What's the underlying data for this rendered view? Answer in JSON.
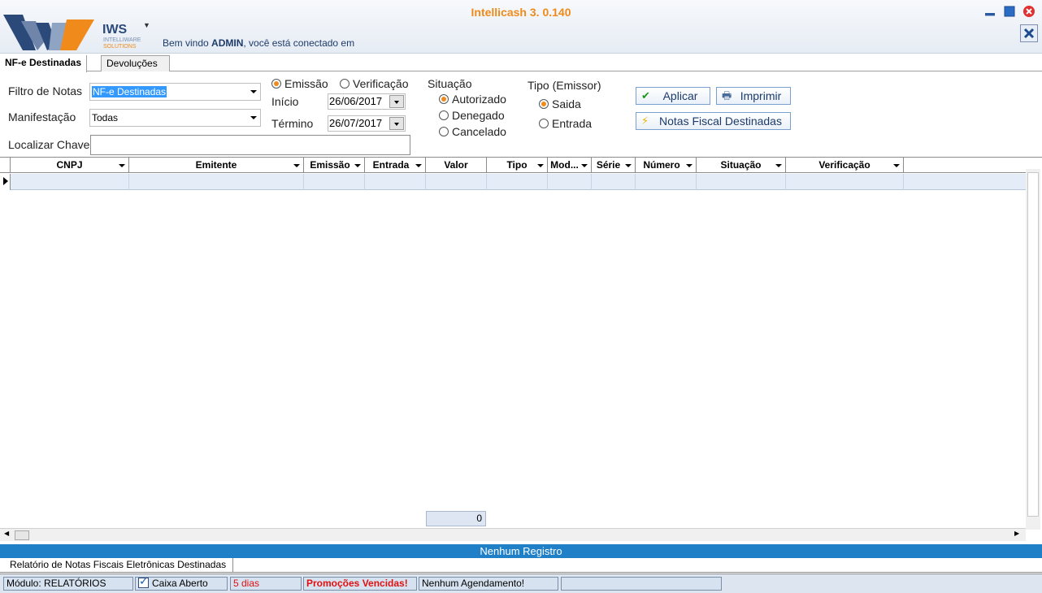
{
  "window": {
    "title": "Intellicash 3. 0.140",
    "logo_text": "IWS",
    "logo_sub_1": "INTELLIWARE",
    "logo_sub_2": "SOLUTIONS",
    "welcome_prefix": "Bem vindo ",
    "welcome_user": "ADMIN",
    "welcome_suffix": ", você está conectado em"
  },
  "tabs": [
    {
      "label": "NF-e Destinadas",
      "active": true
    },
    {
      "label": "Devoluções",
      "active": false
    }
  ],
  "filters": {
    "filtro_label": "Filtro de Notas",
    "filtro_value": "NF-e Destinadas",
    "manifestacao_label": "Manifestação",
    "manifestacao_value": "Todas",
    "localizar_label": "Localizar Chave",
    "localizar_value": "",
    "date_type": {
      "emissao": "Emissão",
      "verificacao": "Verificação",
      "selected": "emissao"
    },
    "inicio_label": "Início",
    "inicio_value": "26/06/2017",
    "termino_label": "Término",
    "termino_value": "26/07/2017",
    "situacao_label": "Situação",
    "situacao_options": [
      "Autorizado",
      "Denegado",
      "Cancelado"
    ],
    "situacao_selected": "Autorizado",
    "tipo_label": "Tipo (Emissor)",
    "tipo_options": [
      "Saida",
      "Entrada"
    ],
    "tipo_selected": "Saida"
  },
  "buttons": {
    "aplicar": "Aplicar",
    "imprimir": "Imprimir",
    "notas": "Notas Fiscal Destinadas"
  },
  "grid": {
    "columns": [
      "CNPJ",
      "Emitente",
      "Emissão",
      "Entrada",
      "Valor",
      "Tipo",
      "Mod...",
      "Série",
      "Número",
      "Situação",
      "Verificação"
    ],
    "total_value": "0"
  },
  "status": {
    "records": "Nenhum Registro",
    "report_tab": "Relatório de Notas Fiscais Eletrônicas Destinadas",
    "modulo": "Módulo: RELATÓRIOS",
    "caixa": "Caixa Aberto",
    "dias": "5 dias",
    "promocoes": "Promoções Vencidas!",
    "agendamento": "Nenhum Agendamento!",
    "extra": ""
  },
  "colors": {
    "accent_orange": "#f08a1a",
    "status_blue": "#1f7fc7",
    "selection_blue": "#3399ff",
    "alert_red": "#e01010"
  }
}
